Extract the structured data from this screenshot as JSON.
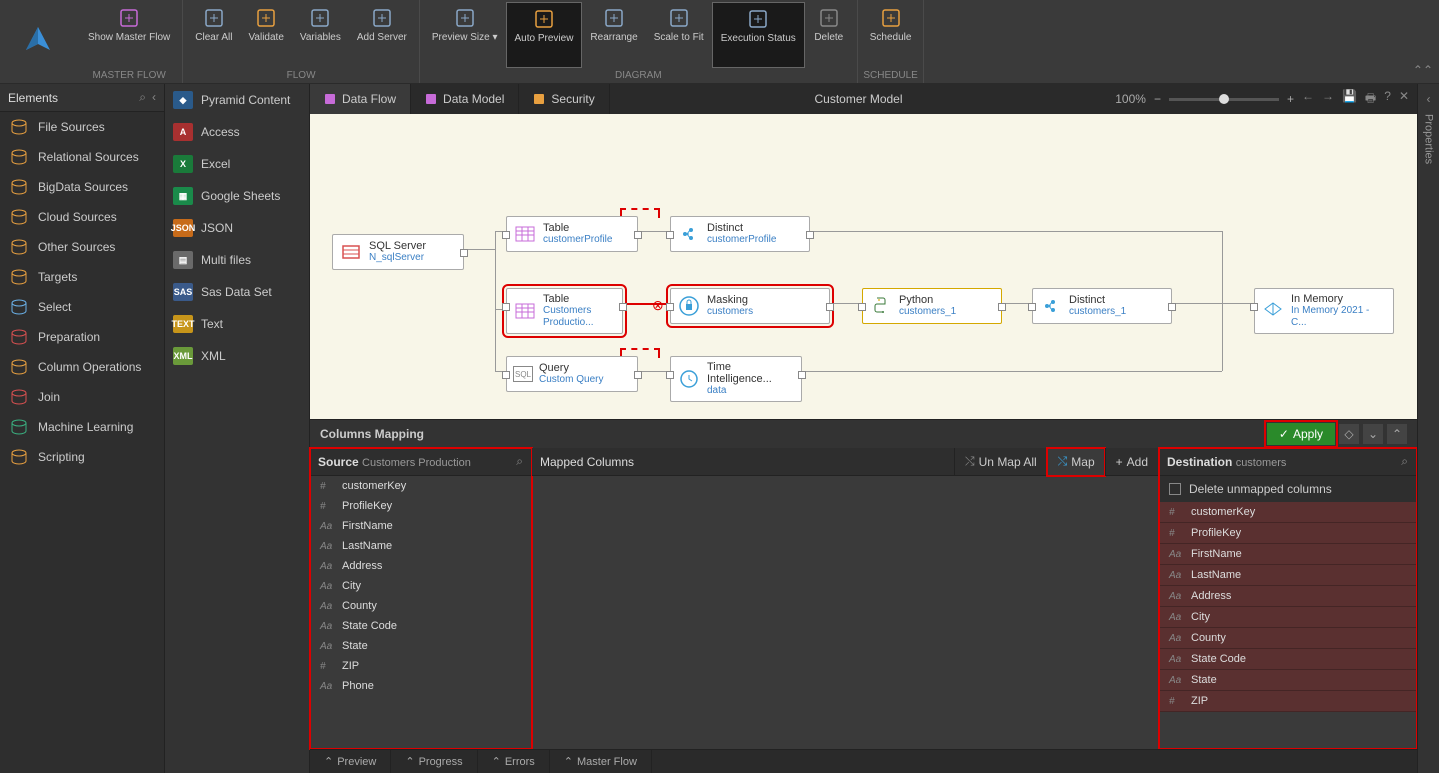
{
  "ribbon": {
    "groups": [
      {
        "label": "MASTER FLOW",
        "buttons": [
          {
            "id": "show-master-flow",
            "label": "Show Master Flow",
            "color": "#c76bd8"
          }
        ]
      },
      {
        "label": "FLOW",
        "buttons": [
          {
            "id": "clear-all",
            "label": "Clear All",
            "color": "#8aa8c8"
          },
          {
            "id": "validate",
            "label": "Validate",
            "color": "#e8a040"
          },
          {
            "id": "variables",
            "label": "Variables",
            "color": "#8aa8c8"
          },
          {
            "id": "add-server",
            "label": "Add Server",
            "color": "#8aa8c8"
          }
        ]
      },
      {
        "label": "DIAGRAM",
        "buttons": [
          {
            "id": "preview-size",
            "label": "Preview Size ▾",
            "color": "#8aa8c8"
          },
          {
            "id": "auto-preview",
            "label": "Auto Preview",
            "color": "#e8a040",
            "active": true
          },
          {
            "id": "rearrange",
            "label": "Rearrange",
            "color": "#8aa8c8"
          },
          {
            "id": "scale-fit",
            "label": "Scale to Fit",
            "color": "#8aa8c8"
          },
          {
            "id": "exec-status",
            "label": "Execution Status",
            "color": "#8aa8c8",
            "active": true
          },
          {
            "id": "delete",
            "label": "Delete",
            "color": "#888"
          }
        ]
      },
      {
        "label": "SCHEDULE",
        "buttons": [
          {
            "id": "schedule",
            "label": "Schedule",
            "color": "#e8a040"
          }
        ]
      }
    ]
  },
  "leftPanel": {
    "title": "Elements",
    "items": [
      {
        "id": "file-sources",
        "label": "File Sources",
        "color": "#e8a040"
      },
      {
        "id": "relational-sources",
        "label": "Relational Sources",
        "color": "#e8a040"
      },
      {
        "id": "bigdata-sources",
        "label": "BigData Sources",
        "color": "#e8a040"
      },
      {
        "id": "cloud-sources",
        "label": "Cloud Sources",
        "color": "#e8a040"
      },
      {
        "id": "other-sources",
        "label": "Other Sources",
        "color": "#e8a040"
      },
      {
        "id": "targets",
        "label": "Targets",
        "color": "#e8a040"
      },
      {
        "id": "select",
        "label": "Select",
        "color": "#6ab0e8"
      },
      {
        "id": "preparation",
        "label": "Preparation",
        "color": "#d85050"
      },
      {
        "id": "column-ops",
        "label": "Column Operations",
        "color": "#e8a040"
      },
      {
        "id": "join",
        "label": "Join",
        "color": "#d85050"
      },
      {
        "id": "ml",
        "label": "Machine Learning",
        "color": "#3ab080"
      },
      {
        "id": "scripting",
        "label": "Scripting",
        "color": "#e8a040"
      }
    ]
  },
  "subPanel": {
    "items": [
      {
        "id": "pyramid",
        "label": "Pyramid Content",
        "bg": "#2a5a8a",
        "txt": "◆"
      },
      {
        "id": "access",
        "label": "Access",
        "bg": "#a83030",
        "txt": "A"
      },
      {
        "id": "excel",
        "label": "Excel",
        "bg": "#1a7a3a",
        "txt": "X"
      },
      {
        "id": "gsheets",
        "label": "Google Sheets",
        "bg": "#1a8a4a",
        "txt": "▦"
      },
      {
        "id": "json",
        "label": "JSON",
        "bg": "#c76b1a",
        "txt": "JSON"
      },
      {
        "id": "multifiles",
        "label": "Multi files",
        "bg": "#6a6a6a",
        "txt": "▤"
      },
      {
        "id": "sas",
        "label": "Sas Data Set",
        "bg": "#3a5a8a",
        "txt": "SAS"
      },
      {
        "id": "text",
        "label": "Text",
        "bg": "#c7951a",
        "txt": "TEXT"
      },
      {
        "id": "xml",
        "label": "XML",
        "bg": "#6a9a3a",
        "txt": "XML"
      }
    ]
  },
  "tabs": [
    {
      "id": "dataflow",
      "label": "Data Flow",
      "active": true,
      "color": "#c76bd8"
    },
    {
      "id": "datamodel",
      "label": "Data Model",
      "color": "#c76bd8"
    },
    {
      "id": "security",
      "label": "Security",
      "color": "#e8a040"
    }
  ],
  "title": "Customer Model",
  "zoom": "100%",
  "nodes": {
    "sqlserver": {
      "title": "SQL Server",
      "sub": "N_sqlServer"
    },
    "table1": {
      "title": "Table",
      "sub": "customerProfile"
    },
    "table2": {
      "title": "Table",
      "sub": "Customers Productio..."
    },
    "query": {
      "title": "Query",
      "sub": "Custom Query"
    },
    "distinct1": {
      "title": "Distinct",
      "sub": "customerProfile"
    },
    "masking": {
      "title": "Masking",
      "sub": "customers"
    },
    "timeint": {
      "title": "Time Intelligence...",
      "sub": "data"
    },
    "python": {
      "title": "Python",
      "sub": "customers_1"
    },
    "distinct2": {
      "title": "Distinct",
      "sub": "customers_1"
    },
    "inmemory": {
      "title": "In Memory",
      "sub": "In Memory 2021 - C..."
    }
  },
  "mapping": {
    "title": "Columns Mapping",
    "apply": "Apply",
    "source": {
      "label": "Source",
      "sub": "Customers Production"
    },
    "mapped": {
      "label": "Mapped Columns",
      "unmapall": "Un Map All",
      "map": "Map",
      "add": "Add"
    },
    "dest": {
      "label": "Destination",
      "sub": "customers",
      "deleteUnmapped": "Delete unmapped columns"
    },
    "srcCols": [
      {
        "t": "#",
        "n": "customerKey"
      },
      {
        "t": "#",
        "n": "ProfileKey"
      },
      {
        "t": "Aa",
        "n": "FirstName"
      },
      {
        "t": "Aa",
        "n": "LastName"
      },
      {
        "t": "Aa",
        "n": "Address"
      },
      {
        "t": "Aa",
        "n": "City"
      },
      {
        "t": "Aa",
        "n": "County"
      },
      {
        "t": "Aa",
        "n": "State Code"
      },
      {
        "t": "Aa",
        "n": "State"
      },
      {
        "t": "#",
        "n": "ZIP"
      },
      {
        "t": "Aa",
        "n": "Phone"
      }
    ],
    "dstCols": [
      {
        "t": "#",
        "n": "customerKey"
      },
      {
        "t": "#",
        "n": "ProfileKey"
      },
      {
        "t": "Aa",
        "n": "FirstName"
      },
      {
        "t": "Aa",
        "n": "LastName"
      },
      {
        "t": "Aa",
        "n": "Address"
      },
      {
        "t": "Aa",
        "n": "City"
      },
      {
        "t": "Aa",
        "n": "County"
      },
      {
        "t": "Aa",
        "n": "State Code"
      },
      {
        "t": "Aa",
        "n": "State"
      },
      {
        "t": "#",
        "n": "ZIP"
      }
    ]
  },
  "bottomTabs": [
    {
      "id": "preview",
      "label": "Preview"
    },
    {
      "id": "progress",
      "label": "Progress"
    },
    {
      "id": "errors",
      "label": "Errors"
    },
    {
      "id": "masterflow",
      "label": "Master Flow"
    }
  ],
  "rightRail": "Properties"
}
